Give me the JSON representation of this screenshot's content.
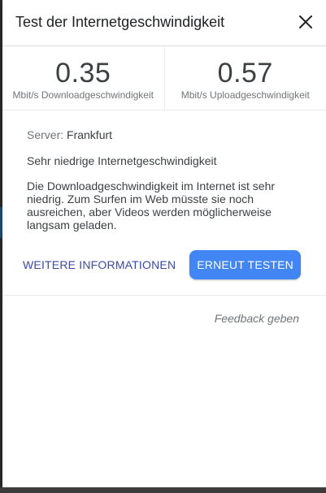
{
  "dialog": {
    "title": "Test der Internetgeschwindigkeit",
    "close_icon": "close-icon"
  },
  "metrics": {
    "download": {
      "value": "0.35",
      "unit": "Mbit/s Downloadgeschwindigkeit"
    },
    "upload": {
      "value": "0.57",
      "unit": "Mbit/s Uploadgeschwindigkeit"
    }
  },
  "details": {
    "server_label": "Server:",
    "server_value": "Frankfurt",
    "quality": "Sehr niedrige Internetgeschwindigkeit",
    "description": "Die Downloadgeschwindigkeit im Internet ist sehr niedrig. Zum Surfen im Web müsste sie noch ausreichen, aber Videos werden möglicherweise langsam geladen."
  },
  "actions": {
    "more_info": "WEITERE INFORMATIONEN",
    "retest": "ERNEUT TESTEN"
  },
  "footer": {
    "feedback": "Feedback geben"
  },
  "colors": {
    "accent": "#4285f4",
    "link": "#3949ab"
  }
}
